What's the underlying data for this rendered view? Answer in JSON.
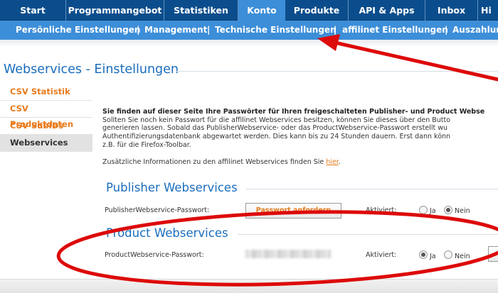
{
  "topnav": {
    "items": [
      "Start",
      "Programmangebot",
      "Statistiken",
      "Konto",
      "Produkte",
      "API & Apps",
      "Inbox",
      "Hi"
    ],
    "active": "Konto"
  },
  "subnav": {
    "items": [
      "Persönliche Einstellungen",
      "Management",
      "Technische Einstellungen",
      "affilinet Einstellungen",
      "Auszahlun"
    ],
    "separator": "|"
  },
  "page": {
    "title": "Webservices - Einstellungen"
  },
  "sidebar": {
    "items": [
      "CSV Statistik",
      "CSV Produktdaten",
      "CSV SubIDs",
      "Webservices"
    ],
    "active": "Webservices"
  },
  "intro": {
    "lines": [
      "Sie finden auf dieser Seite Ihre Passwörter für Ihren freigeschalteten Publisher- und Product Webse",
      "Sollten Sie noch kein Passwort für die affilinet Webservices besitzen, können Sie dieses über den Butto",
      "generieren lassen. Sobald das PublisherWebservice- oder das ProductWebservice-Passwort erstellt wu",
      "Authentifizierungsdatenbank abgewartet werden. Dies kann bis zu 24 Stunden dauern. Erst dann könn",
      "z.B. für die Firefox-Toolbar."
    ],
    "info_text": "Zusätzliche Informationen zu den affilinet Webservices finden Sie ",
    "info_link": "hier",
    "info_end": "."
  },
  "publisher": {
    "section_title": "Publisher Webservices",
    "label": "PublisherWebservice-Passwort:",
    "button": "Passwort anfordern",
    "activated_label": "Aktiviert:",
    "yes": "Ja",
    "no": "Nein",
    "selected": "Nein"
  },
  "product": {
    "section_title": "Product Webservices",
    "label": "ProductWebservice-Passwort:",
    "activated_label": "Aktiviert:",
    "yes": "Ja",
    "no": "Nein",
    "selected": "Ja"
  },
  "colors": {
    "nav_dark": "#0b4d8c",
    "nav_light": "#3d8ed8",
    "title_blue": "#1a6dbd",
    "accent_orange": "#e87b1c",
    "annotation_red": "#dd0a0a"
  }
}
